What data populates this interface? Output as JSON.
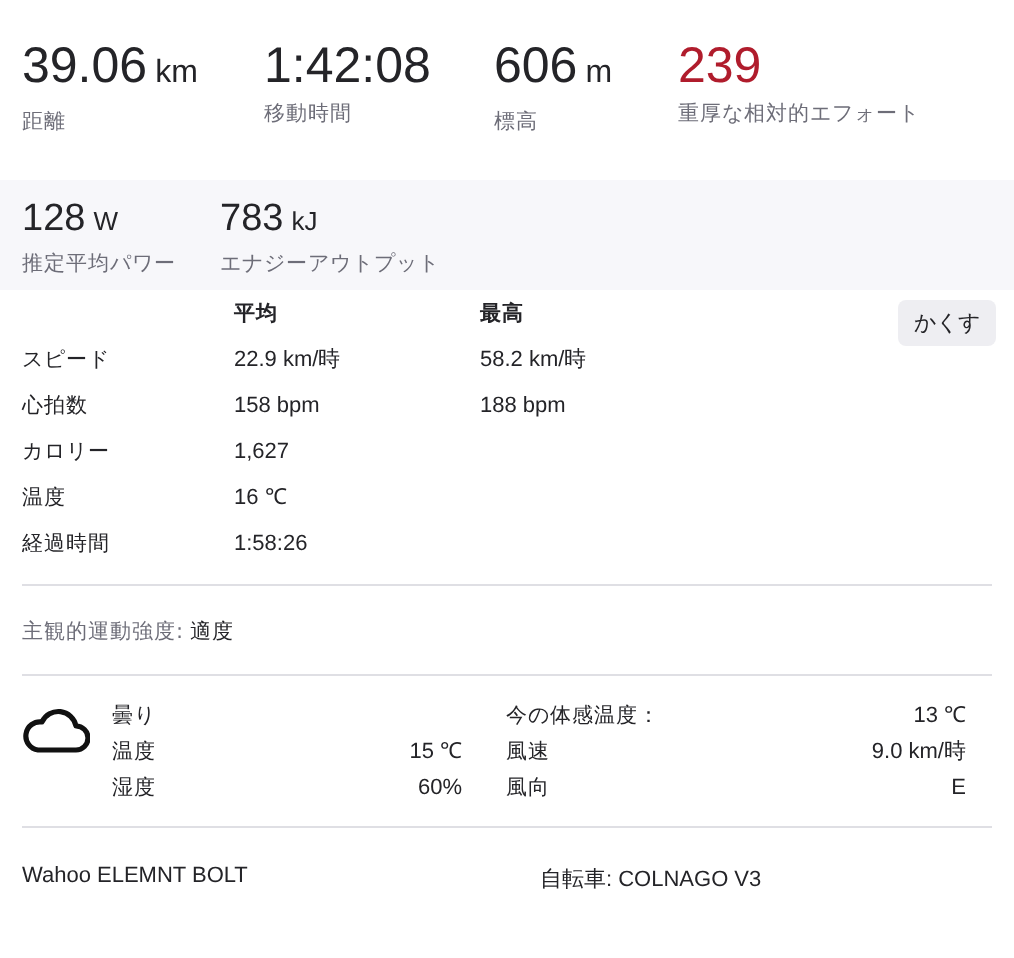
{
  "primary_stats": [
    {
      "value": "39.06",
      "unit": "km",
      "label": "距離",
      "emphasis": false
    },
    {
      "value": "1:42:08",
      "label": "移動時間",
      "emphasis": false
    },
    {
      "value": "606",
      "unit": "m",
      "label": "標高",
      "emphasis": false
    },
    {
      "value": "239",
      "label": "重厚な相対的エフォート",
      "emphasis": true
    }
  ],
  "secondary_stats": [
    {
      "value": "128",
      "unit": "W",
      "label": "推定平均パワー"
    },
    {
      "value": "783",
      "unit": "kJ",
      "label": "エナジーアウトプット"
    }
  ],
  "details": {
    "columns": [
      "平均",
      "最高"
    ],
    "hide_button": "かくす",
    "rows": [
      {
        "label": "スピード",
        "avg": "22.9 km/時",
        "max": "58.2 km/時"
      },
      {
        "label": "心拍数",
        "avg": "158 bpm",
        "max": "188 bpm"
      },
      {
        "label": "カロリー",
        "avg": "1,627"
      },
      {
        "label": "温度",
        "avg": "16 ℃"
      },
      {
        "label": "経過時間",
        "avg": "1:58:26"
      }
    ]
  },
  "perceived_exertion": {
    "label": "主観的運動強度:",
    "value": "適度"
  },
  "weather": {
    "condition": "曇り",
    "left": [
      {
        "label": "温度",
        "value": "15 ℃"
      },
      {
        "label": "湿度",
        "value": "60%"
      }
    ],
    "right": [
      {
        "label": "今の体感温度：",
        "value": "13 ℃"
      },
      {
        "label": "風速",
        "value": "9.0 km/時"
      },
      {
        "label": "風向",
        "value": "E"
      }
    ]
  },
  "footer": {
    "device": "Wahoo ELEMNT BOLT",
    "bike": "自転車: COLNAGO V3"
  }
}
